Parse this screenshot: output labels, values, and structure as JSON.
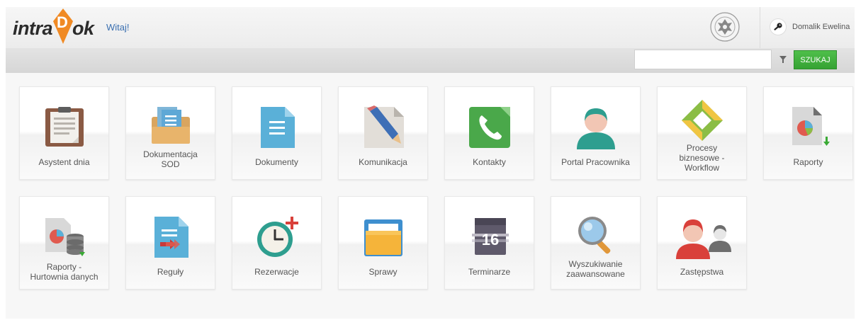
{
  "header": {
    "logo_left": "intra",
    "logo_mark": "D",
    "logo_right": "ok",
    "welcome": "Witaj!",
    "user_name": "Domalik Ewelina"
  },
  "search": {
    "value": "",
    "placeholder": "",
    "button": "SZUKAJ"
  },
  "tiles": [
    {
      "label": "Asystent dnia",
      "icon": "clipboard-icon"
    },
    {
      "label": "Dokumentacja\nSOD",
      "icon": "folder-documents-icon"
    },
    {
      "label": "Dokumenty",
      "icon": "document-icon"
    },
    {
      "label": "Komunikacja",
      "icon": "pencil-icon"
    },
    {
      "label": "Kontakty",
      "icon": "phone-icon"
    },
    {
      "label": "Portal Pracownika",
      "icon": "person-icon"
    },
    {
      "label": "Procesy\nbiznesowe -\nWorkflow",
      "icon": "workflow-icon"
    },
    {
      "label": "Raporty",
      "icon": "report-chart-icon"
    },
    {
      "label": "Raporty -\nHurtownia danych",
      "icon": "report-database-icon"
    },
    {
      "label": "Reguły",
      "icon": "rules-document-icon"
    },
    {
      "label": "Rezerwacje",
      "icon": "clock-add-icon"
    },
    {
      "label": "Sprawy",
      "icon": "folder-icon"
    },
    {
      "label": "Terminarze",
      "icon": "calendar-icon"
    },
    {
      "label": "Wyszukiwanie\nzaawansowane",
      "icon": "magnifier-icon"
    },
    {
      "label": "Zastępstwa",
      "icon": "substitute-users-icon"
    }
  ],
  "calendar_day": "16",
  "colors": {
    "search_button": "#3cad39",
    "logo_accent": "#f08a24",
    "welcome_link": "#3a6fb0"
  }
}
